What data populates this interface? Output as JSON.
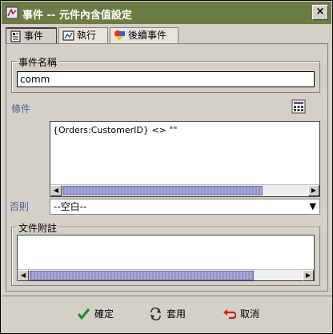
{
  "window": {
    "title": "事件 -- 元件內含值設定",
    "close_symbol": "×"
  },
  "tabs": [
    {
      "label": "事件",
      "icon": "event-doc-icon",
      "active": true
    },
    {
      "label": "執行",
      "icon": "chart-icon",
      "active": false
    },
    {
      "label": "後續事件",
      "icon": "shapes-icon",
      "active": false
    }
  ],
  "event_name": {
    "label": "事件名稱",
    "value": "comm"
  },
  "condition": {
    "label": "條件",
    "value": "{Orders:CustomerID}  <>  \"\""
  },
  "otherwise": {
    "label": "否則",
    "selected": "--空白--"
  },
  "document_note": {
    "label": "文件附註",
    "value": ""
  },
  "buttons": {
    "ok": "確定",
    "apply": "套用",
    "cancel": "取消"
  },
  "colors": {
    "titlebar": "#6b7d42",
    "dialog": "#d4d0c8",
    "label_blue": "#4c5f8c",
    "scroll_thumb": "#a7aad6"
  }
}
